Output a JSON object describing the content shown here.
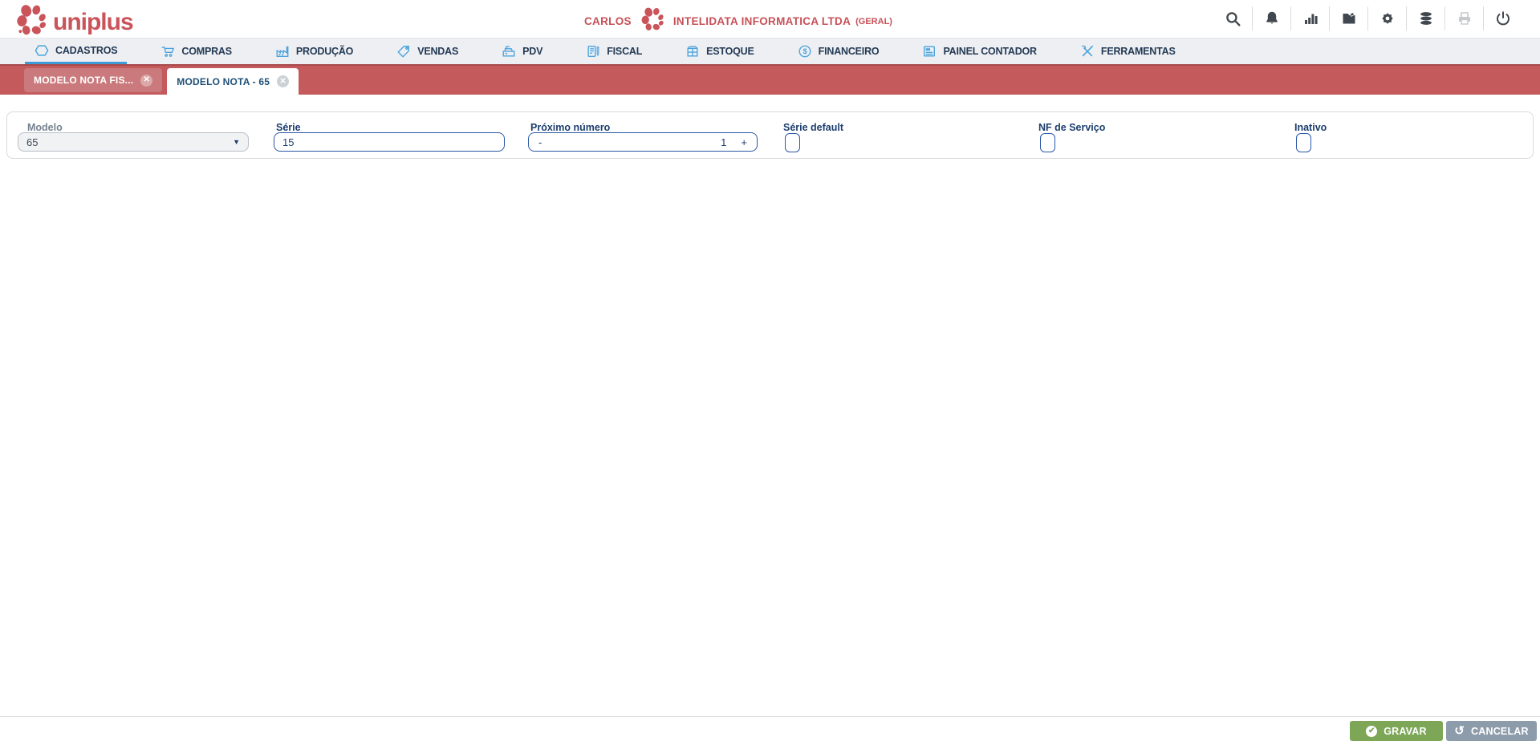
{
  "header": {
    "logo_text": "uniplus",
    "user_name": "CARLOS",
    "company_name": "INTELIDATA INFORMATICA LTDA",
    "company_scope": "(GERAL)",
    "action_icons": [
      "search",
      "notifications",
      "statistics",
      "documents",
      "settings",
      "database",
      "print",
      "power"
    ],
    "print_disabled": true
  },
  "menu": {
    "items": [
      {
        "label": "CADASTROS",
        "icon": "hexagon",
        "active": true
      },
      {
        "label": "COMPRAS",
        "icon": "shopping-cart",
        "active": false
      },
      {
        "label": "PRODUÇÃO",
        "icon": "factory",
        "active": false
      },
      {
        "label": "VENDAS",
        "icon": "price-tag",
        "active": false
      },
      {
        "label": "PDV",
        "icon": "cash-register",
        "active": false
      },
      {
        "label": "FISCAL",
        "icon": "clipboard",
        "active": false
      },
      {
        "label": "ESTOQUE",
        "icon": "crate",
        "active": false
      },
      {
        "label": "FINANCEIRO",
        "icon": "dollar-circle",
        "active": false
      },
      {
        "label": "PAINEL CONTADOR",
        "icon": "calculator-panel",
        "active": false
      },
      {
        "label": "FERRAMENTAS",
        "icon": "tools",
        "active": false
      }
    ]
  },
  "tab_bar": {
    "tabs": [
      {
        "label": "MODELO NOTA FIS...",
        "state": "inactive",
        "close_glyph": "✕"
      },
      {
        "label": "MODELO NOTA - 65",
        "state": "active",
        "close_glyph": "✕"
      }
    ]
  },
  "form": {
    "modelo": {
      "label": "Modelo",
      "value": "65",
      "disabled": true
    },
    "serie": {
      "label": "Série",
      "value": "15"
    },
    "proximo_numero": {
      "label": "Próximo número",
      "value": "1",
      "decrement_label": "-",
      "increment_label": "+"
    },
    "serie_default": {
      "label": "Série default",
      "checked": false
    },
    "nf_de_servico": {
      "label": "NF de Serviço",
      "checked": false
    },
    "inativo": {
      "label": "Inativo",
      "checked": false
    }
  },
  "footer": {
    "save_label": "GRAVAR",
    "cancel_label": "CANCELAR"
  },
  "colors": {
    "brand_red": "#c9545a",
    "tab_bar_red": "#c45a5c",
    "tab_bar_top_border": "#a84a4e",
    "inactive_tab_red": "#ca7a7c",
    "menu_bar_gray": "#edeff3",
    "menu_icon_blue": "#4aa3dc",
    "active_underline_blue": "#3e9bd6",
    "navy_text": "#1c3e6e",
    "field_border_blue": "#2b57a5",
    "save_green": "#7da757",
    "cancel_gray": "#8d9cab"
  }
}
